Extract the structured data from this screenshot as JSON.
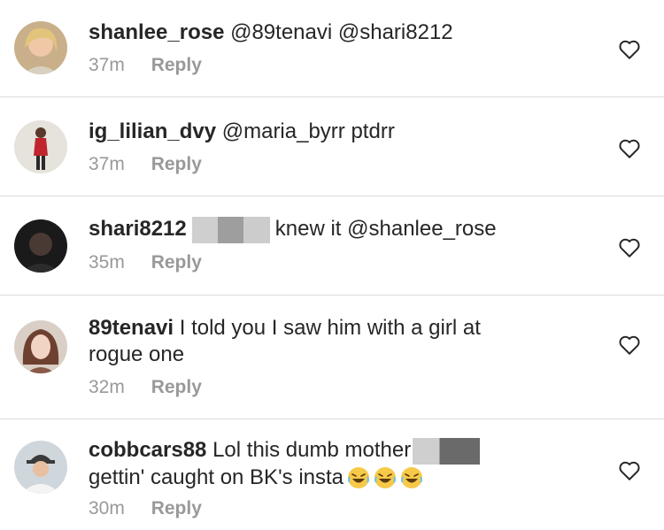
{
  "comments": [
    {
      "username": "shanlee_rose",
      "text": "@89tenavi @shari8212",
      "time": "37m",
      "reply": "Reply",
      "avatar": "woman-blonde-avatar"
    },
    {
      "username": "ig_lilian_dvy",
      "text": "@maria_byrr ptdrr",
      "time": "37m",
      "reply": "Reply",
      "avatar": "woman-red-dress-avatar"
    },
    {
      "username": "shari8212",
      "text_after_redaction": "knew it @shanlee_rose",
      "time": "35m",
      "reply": "Reply",
      "avatar": "dark-avatar"
    },
    {
      "username": "89tenavi",
      "text_line1": "I told you I saw him with a girl at",
      "text_line2": "rogue one",
      "time": "32m",
      "reply": "Reply",
      "avatar": "woman-brunette-avatar"
    },
    {
      "username": "cobbcars88",
      "text_line1": "Lol this dumb mother",
      "text_line2": "gettin' caught on BK's insta",
      "time": "30m",
      "reply": "Reply",
      "avatar": "man-cap-avatar"
    }
  ],
  "colors": {
    "text": "#262626",
    "meta": "#999999",
    "divider": "#dbdbdb",
    "emoji_face": "#f7c948"
  },
  "icons": {
    "like": "heart-outline-icon",
    "emoji": "face-with-tears-of-joy"
  }
}
